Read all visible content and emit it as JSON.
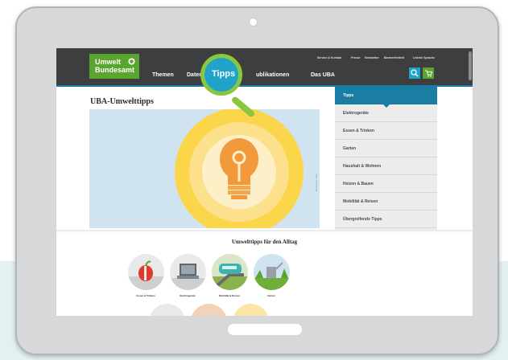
{
  "logo": {
    "line1": "Umwelt",
    "line2": "Bundesamt"
  },
  "nav": {
    "themen": "Themen",
    "daten": "Daten",
    "publikationen": "ublikationen",
    "das_uba": "Das UBA"
  },
  "service_links": [
    "Service & Kontakt",
    "Presse",
    "Newsletter",
    "Barrierefreiheit",
    "Leichte Sprache"
  ],
  "magnifier": {
    "label": "Tipps"
  },
  "page": {
    "title": "UBA-Umwelttipps",
    "image_credit": "Illustration: UBA"
  },
  "sidebar": {
    "items": [
      {
        "label": "Tipps"
      },
      {
        "label": "Elektrogeräte"
      },
      {
        "label": "Essen & Trinken"
      },
      {
        "label": "Garten"
      },
      {
        "label": "Haushalt & Wohnen"
      },
      {
        "label": "Heizen & Bauen"
      },
      {
        "label": "Mobilität & Reisen"
      },
      {
        "label": "Übergreifende Tipps"
      }
    ]
  },
  "section": {
    "title": "Umwelttipps für den Alltag",
    "categories": [
      {
        "label": "Essen & Trinken",
        "icon": "apple-icon"
      },
      {
        "label": "Elektrogeräte",
        "icon": "laptop-icon"
      },
      {
        "label": "Mobilität & Reisen",
        "icon": "train-icon"
      },
      {
        "label": "Garten",
        "icon": "watering-can-icon"
      }
    ]
  },
  "colors": {
    "brand_green": "#5aa52e",
    "accent_blue": "#1a7da3",
    "magnifier_green": "#8cc63f",
    "topbar": "#3c3e3f"
  }
}
